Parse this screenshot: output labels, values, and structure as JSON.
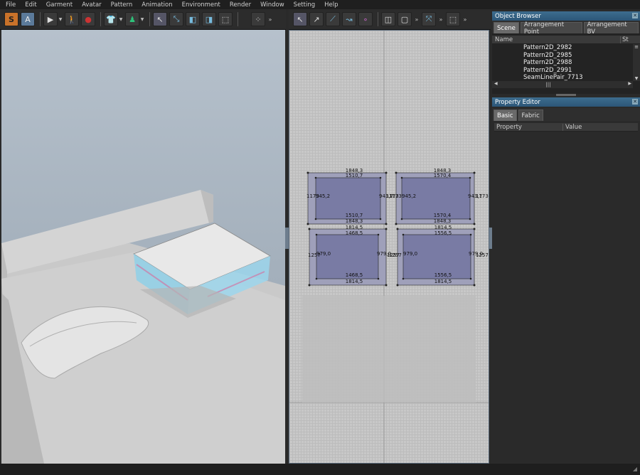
{
  "menu": [
    "File",
    "Edit",
    "Garment",
    "Avatar",
    "Pattern",
    "Animation",
    "Environment",
    "Render",
    "Window",
    "Setting",
    "Help"
  ],
  "toolbar": {
    "simulation_mode_label": "S",
    "animation_mode_label": "A",
    "more_glyph": "»"
  },
  "object_browser": {
    "title": "Object Browser",
    "tabs": [
      "Scene",
      "Arrangement Point",
      "Arrangement BV"
    ],
    "column_name": "Name",
    "column_short": "St",
    "items": [
      "Pattern2D_2982",
      "Pattern2D_2985",
      "Pattern2D_2988",
      "Pattern2D_2991",
      "SeamLinePair_7713"
    ]
  },
  "property_editor": {
    "title": "Property Editor",
    "tabs": [
      "Basic",
      "Fabric"
    ],
    "column_property": "Property",
    "column_value": "Value"
  },
  "patterns": [
    {
      "top_outer": "1848,3",
      "top_inner": "1510,7",
      "left_outer": "1173",
      "left_inner": "945,2",
      "right_inner": "943,7",
      "right_outer": "1173",
      "bottom_inner": "1510,7",
      "bottom_outer": "1848,3"
    },
    {
      "top_outer": "1848,3",
      "top_inner": "1570,4",
      "left_outer": "1173",
      "left_inner": "945,2",
      "right_inner": "943,7",
      "right_outer": "1173,1",
      "bottom_inner": "1570,4",
      "bottom_outer": "1848,3"
    },
    {
      "top_outer": "1814,5",
      "top_inner": "1468,5",
      "left_outer": "1257",
      "left_inner": "979,0",
      "right_inner": "979,0",
      "right_outer": "1257",
      "bottom_inner": "1468,5",
      "bottom_outer": "1814,5"
    },
    {
      "top_outer": "1814,5",
      "top_inner": "1556,5",
      "left_outer": "1257",
      "left_inner": "979,0",
      "right_inner": "979,0",
      "right_outer": "1257,5",
      "bottom_inner": "1556,5",
      "bottom_outer": "1814,5"
    }
  ]
}
